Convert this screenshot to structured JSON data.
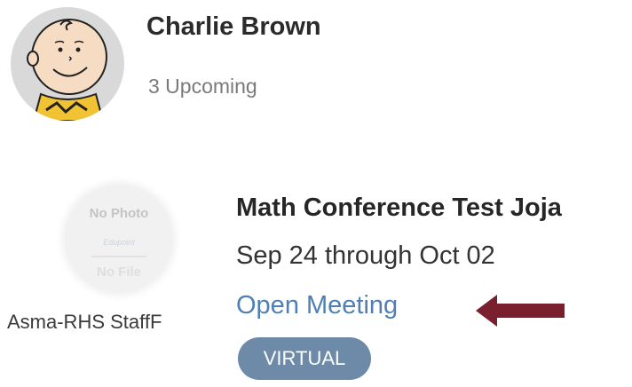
{
  "student": {
    "name": "Charlie Brown",
    "upcoming": "3 Upcoming"
  },
  "meeting": {
    "host_photo_placeholder": "No Photo",
    "host_photo_brand": "Edupoint",
    "host_photo_footer": "No File",
    "host": "Asma-RHS StaffF",
    "title": "Math Conference Test Joja",
    "dates": "Sep 24 through Oct 02",
    "link_label": "Open Meeting",
    "badge": "VIRTUAL"
  },
  "colors": {
    "link": "#4f7fb5",
    "badge_bg": "#6d8aa8",
    "arrow": "#7a1f2e"
  },
  "icons": {
    "student_avatar": "charlie-brown-avatar-icon",
    "host_avatar": "no-photo-icon",
    "pointer": "arrow-left-icon"
  }
}
